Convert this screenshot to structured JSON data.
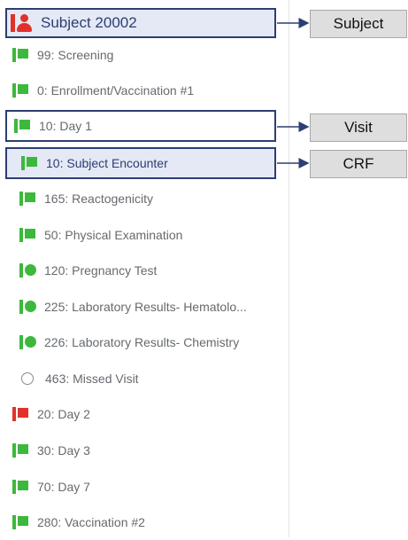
{
  "subject": {
    "label": "Subject 20002"
  },
  "tree_items": [
    {
      "label": "99: Screening"
    },
    {
      "label": "0: Enrollment/Vaccination #1"
    },
    {
      "label": "10: Day 1"
    },
    {
      "label": "10: Subject Encounter"
    },
    {
      "label": "165: Reactogenicity"
    },
    {
      "label": "50: Physical Examination"
    },
    {
      "label": "120: Pregnancy Test"
    },
    {
      "label": "225: Laboratory Results- Hematolo..."
    },
    {
      "label": "226: Laboratory Results- Chemistry"
    },
    {
      "label": "463: Missed Visit"
    },
    {
      "label": "20: Day 2"
    },
    {
      "label": "30: Day 3"
    },
    {
      "label": "70: Day 7"
    },
    {
      "label": "280: Vaccination #2"
    }
  ],
  "callouts": {
    "subject": "Subject",
    "visit": "Visit",
    "crf": "CRF"
  },
  "colors": {
    "selection": "#2c3e72",
    "complete": "#3cb93c",
    "incomplete": "#e2312b"
  },
  "icons": {
    "subject": "person-icon",
    "complete_flag": "green-flag-icon",
    "incomplete_flag": "red-flag-icon",
    "complete_dot": "green-dot-icon",
    "empty_circle": "empty-circle-icon"
  }
}
